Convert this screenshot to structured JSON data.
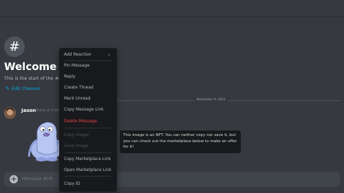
{
  "channel": {
    "welcome_title": "Welcome to",
    "start_text": "This is the start of the #nft",
    "edit_channel": "Edit Channel",
    "hash_glyph": "#"
  },
  "divider": {
    "date": "November 9, 2021"
  },
  "message": {
    "author": "Jason",
    "timestamp": "Today at 5:49",
    "image_alt": "nft-ghost-character"
  },
  "input": {
    "placeholder": "Message #nft",
    "plus": "+"
  },
  "context_menu": {
    "items": [
      {
        "label": "Add Reaction",
        "submenu": true
      },
      {
        "label": "Pin Message"
      },
      {
        "label": "Reply"
      },
      {
        "label": "Create Thread"
      },
      {
        "label": "Mark Unread"
      },
      {
        "label": "Copy Message Link"
      },
      {
        "label": "Delete Message",
        "danger": true
      },
      {
        "label": "Copy Image",
        "disabled": true
      },
      {
        "label": "Save Image",
        "disabled": true
      },
      {
        "label": "Copy Marketplace Link"
      },
      {
        "label": "Open Marketplace Link"
      },
      {
        "label": "Copy ID"
      }
    ],
    "chevron": "›"
  },
  "tooltip": {
    "text": "This image is an NFT. You can neither copy nor save it, but you can check out the marketplace below to make an offer for it!"
  },
  "colors": {
    "background": "#36393f",
    "menu": "#18191c",
    "link": "#00aff4",
    "danger": "#ed4245"
  }
}
